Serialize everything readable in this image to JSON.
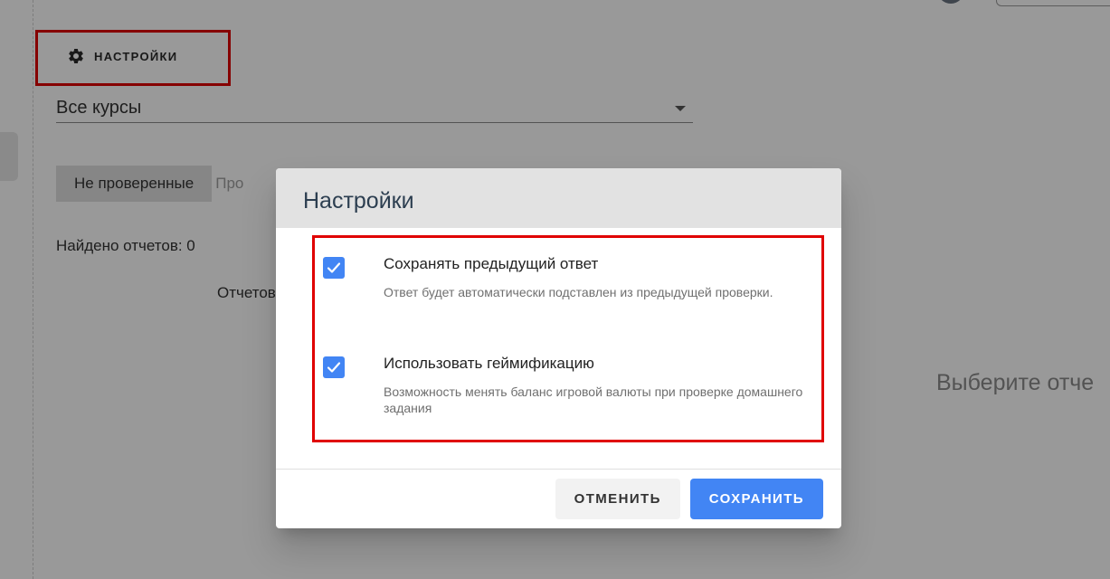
{
  "toolbar": {
    "settings_label": "НАСТРОЙКИ",
    "settings_icon": "gear-icon"
  },
  "course_filter": {
    "selected": "Все курсы"
  },
  "status_tabs": [
    {
      "label": "Не проверенные",
      "active": true
    },
    {
      "label": "Про",
      "active": false
    }
  ],
  "reports": {
    "found_text": "Найдено отчетов: 0",
    "list_label": "Отчетов"
  },
  "detail_panel": {
    "hint": "Выберите отче"
  },
  "dialog": {
    "title": "Настройки",
    "options": [
      {
        "label": "Сохранять предыдущий ответ",
        "description": "Ответ будет автоматически подставлен из предыдущей проверки.",
        "checked": true
      },
      {
        "label": "Использовать геймификацию",
        "description": "Возможность менять баланс игровой валюты при проверке домашнего задания",
        "checked": true
      }
    ],
    "cancel_label": "ОТМЕНИТЬ",
    "save_label": "СОХРАНИТЬ"
  },
  "colors": {
    "accent": "#4285f4",
    "highlight": "#e00000",
    "overlay": "rgba(0,0,0,0.40)"
  }
}
